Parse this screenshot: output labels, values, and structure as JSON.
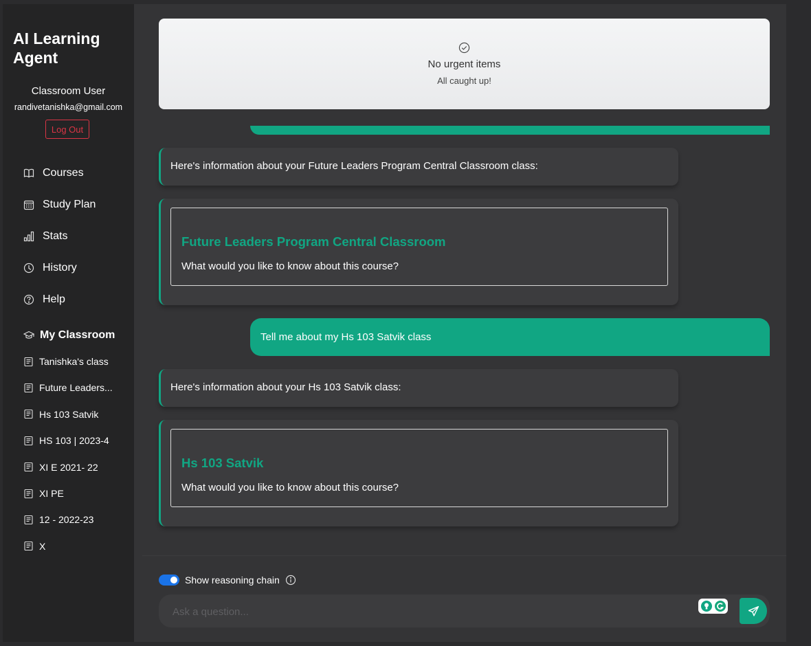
{
  "app": {
    "title": "AI Learning Agent"
  },
  "user": {
    "name": "Classroom User",
    "email": "randivetanishka@gmail.com",
    "logout_label": "Log Out"
  },
  "nav": [
    {
      "label": "Courses",
      "icon": "book-icon"
    },
    {
      "label": "Study Plan",
      "icon": "calendar-icon"
    },
    {
      "label": "Stats",
      "icon": "bar-chart-icon"
    },
    {
      "label": "History",
      "icon": "clock-icon"
    },
    {
      "label": "Help",
      "icon": "help-circle-icon"
    }
  ],
  "classroom": {
    "heading": "My Classroom",
    "classes": [
      "Tanishka's class",
      "Future Leaders...",
      "Hs 103 Satvik",
      "HS 103 | 2023-4",
      "XI E 2021- 22",
      "XI PE",
      "12 - 2022-23",
      "X"
    ]
  },
  "notice": {
    "title": "No urgent items",
    "subtitle": "All caught up!"
  },
  "chat": {
    "messages": [
      {
        "role": "assistant",
        "text": "Here's information about your Future Leaders Program Central Classroom class:"
      },
      {
        "role": "assistant-card",
        "course": "Future Leaders Program Central Classroom",
        "question": "What would you like to know about this course?"
      },
      {
        "role": "user",
        "text": "Tell me about my Hs 103 Satvik class"
      },
      {
        "role": "assistant",
        "text": "Here's information about your Hs 103 Satvik class:"
      },
      {
        "role": "assistant-card",
        "course": "Hs 103 Satvik",
        "question": "What would you like to know about this course?"
      }
    ]
  },
  "composer": {
    "reasoning_label": "Show reasoning chain",
    "reasoning_enabled": true,
    "placeholder": "Ask a question..."
  },
  "colors": {
    "accent": "#11a683",
    "danger": "#dc3545",
    "toggle": "#1a73e8"
  }
}
